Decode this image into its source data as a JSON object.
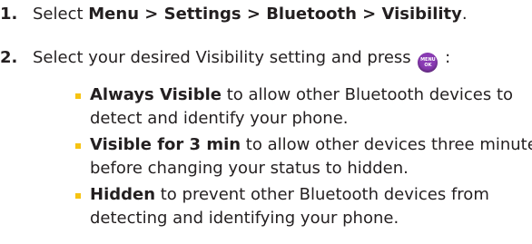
{
  "steps": [
    {
      "number": "1.",
      "parts": [
        {
          "text": "Select "
        },
        {
          "text": "Menu > Settings > Bluetooth > Visibility",
          "bold": true
        },
        {
          "text": "."
        }
      ]
    },
    {
      "number": "2.",
      "before_icon": "Select your desired Visibility setting and press ",
      "icon": {
        "name": "menu-ok-key-icon",
        "line1": "MENU",
        "line2": "OK"
      },
      "after_icon": ":"
    }
  ],
  "options": [
    {
      "term": "Always Visible",
      "line1": " to allow other Bluetooth devices to",
      "line2": "detect and identify your phone."
    },
    {
      "term": "Visible for 3 min",
      "line1": " to allow other devices three minutes",
      "line2": "before changing your status to hidden."
    },
    {
      "term": "Hidden",
      "line1": " to prevent other Bluetooth devices from",
      "line2": "detecting and identifying your phone."
    }
  ],
  "colors": {
    "bullet": "#f6c312",
    "key": "#8a3bb4",
    "text": "#231f20"
  }
}
